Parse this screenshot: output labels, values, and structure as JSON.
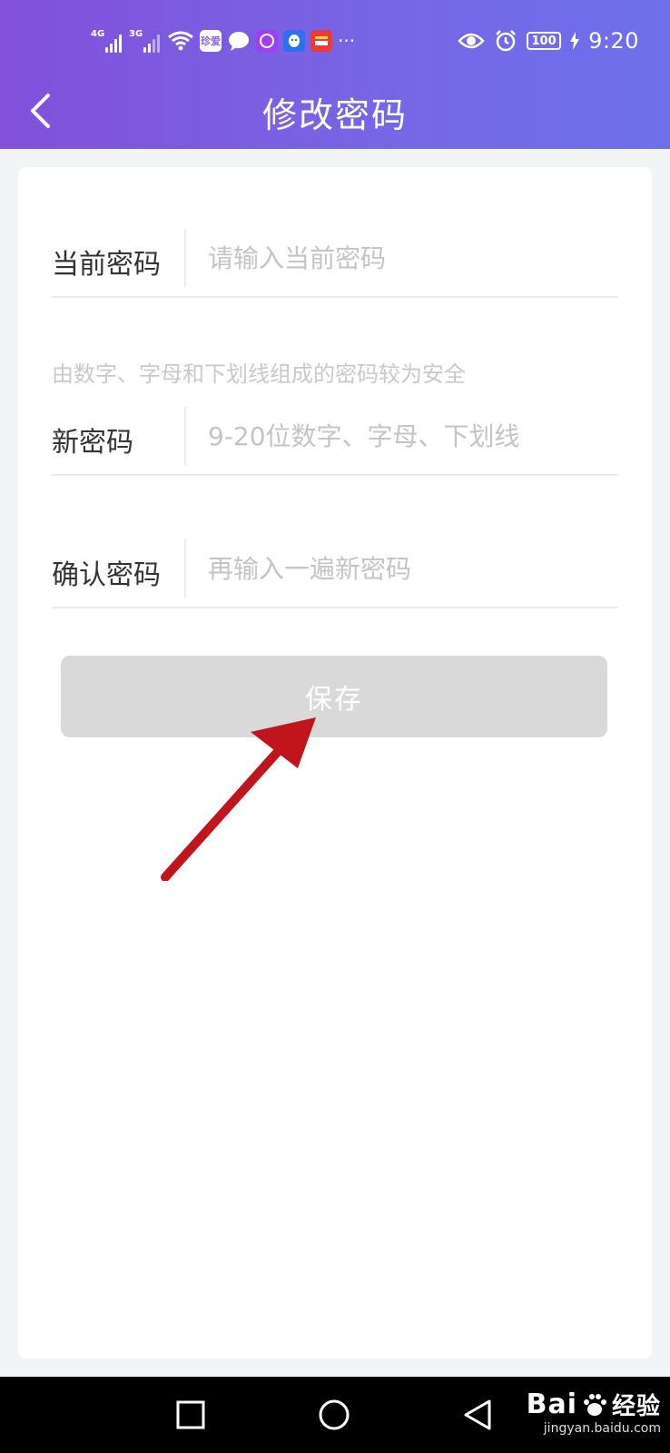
{
  "status_bar": {
    "net1": "4G",
    "net2": "3G",
    "app_icon_label": "珍爱",
    "more": "···",
    "battery": "100",
    "time": "9:20"
  },
  "header": {
    "title": "修改密码"
  },
  "form": {
    "current": {
      "label": "当前密码",
      "placeholder": "请输入当前密码"
    },
    "hint": "由数字、字母和下划线组成的密码较为安全",
    "new": {
      "label": "新密码",
      "placeholder": "9-20位数字、字母、下划线"
    },
    "confirm": {
      "label": "确认密码",
      "placeholder": "再输入一遍新密码"
    },
    "save_label": "保存"
  },
  "colors": {
    "header_start": "#8250da",
    "header_end": "#6e70ec",
    "save_disabled": "#d9d9d9",
    "annotation_arrow": "#c0161b"
  },
  "watermark": {
    "logo": "Bai",
    "logo_suffix": "经验",
    "url": "jingyan.baidu.com"
  }
}
